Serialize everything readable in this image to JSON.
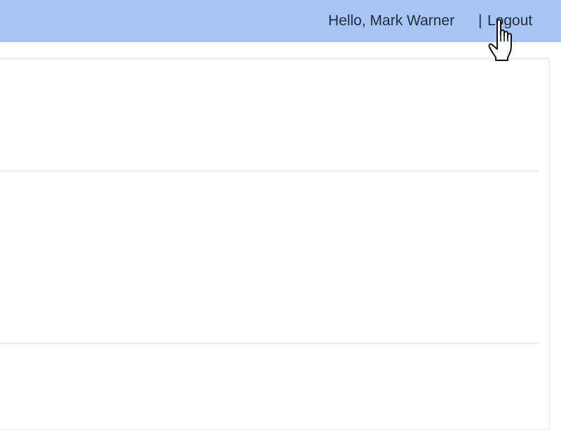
{
  "header": {
    "greeting": "Hello, Mark Warner",
    "separator": "|",
    "logout_label": "Logout",
    "background_color": "#a6c4f4"
  },
  "cursor": {
    "icon": "hand-pointer-icon"
  }
}
